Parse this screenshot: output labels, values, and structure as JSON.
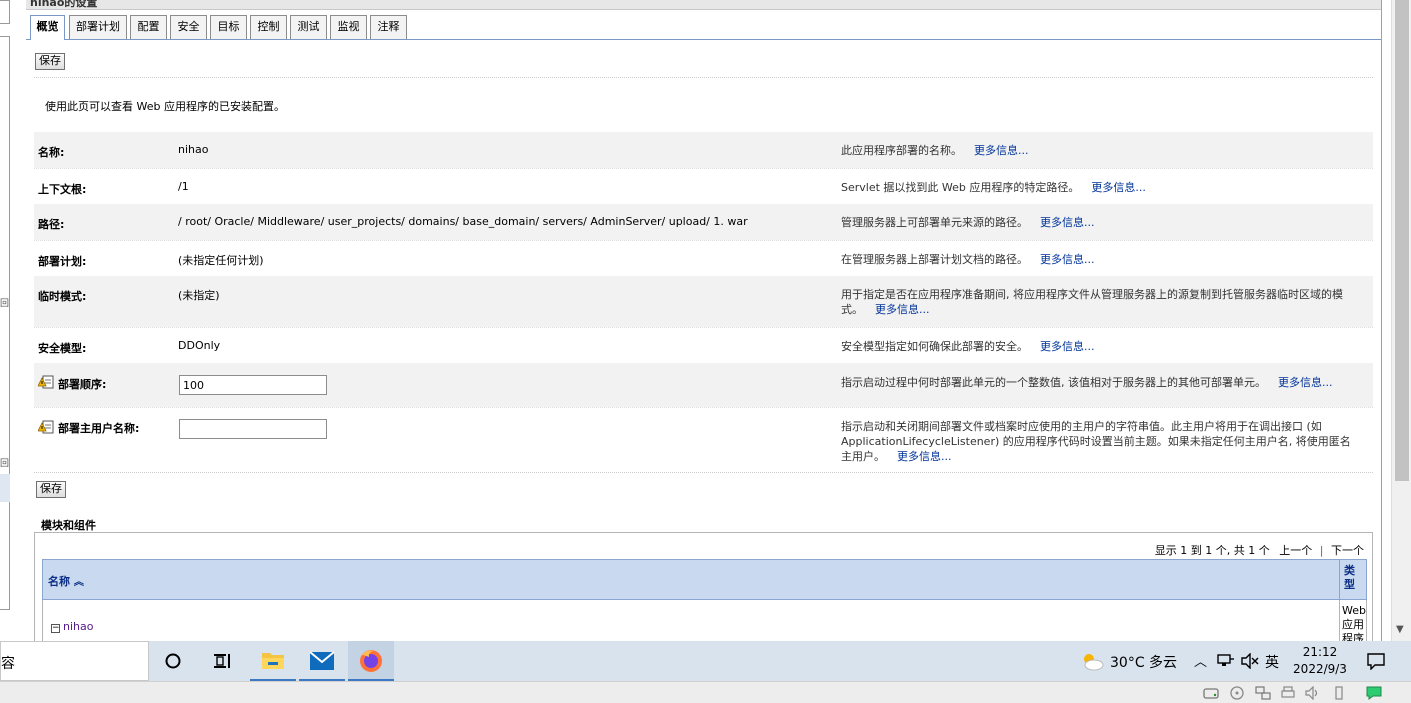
{
  "header": {
    "title": "nihao的设置"
  },
  "tabs": [
    {
      "label": "概览",
      "active": true
    },
    {
      "label": "部署计划"
    },
    {
      "label": "配置"
    },
    {
      "label": "安全"
    },
    {
      "label": "目标"
    },
    {
      "label": "控制"
    },
    {
      "label": "测试"
    },
    {
      "label": "监视"
    },
    {
      "label": "注释"
    }
  ],
  "buttons": {
    "save_label": "保存"
  },
  "intro": "使用此页可以查看 Web 应用程序的已安装配置。",
  "more_info": "更多信息...",
  "fields": {
    "name": {
      "label": "名称:",
      "value": "nihao",
      "desc": "此应用程序部署的名称。"
    },
    "context_root": {
      "label": "上下文根:",
      "value": "/1",
      "desc": "Servlet 据以找到此 Web 应用程序的特定路径。"
    },
    "path": {
      "label": "路径:",
      "value": "/ root/ Oracle/ Middleware/ user_projects/ domains/ base_domain/ servers/ AdminServer/ upload/ 1. war",
      "desc": "管理服务器上可部署单元来源的路径。"
    },
    "plan": {
      "label": "部署计划:",
      "value": "(未指定任何计划)",
      "desc": "在管理服务器上部署计划文档的路径。"
    },
    "staging": {
      "label": "临时模式:",
      "value": "(未指定)",
      "desc": "用于指定是否在应用程序准备期间, 将应用程序文件从管理服务器上的源复制到托管服务器临时区域的模式。"
    },
    "security_model": {
      "label": "安全模型:",
      "value": "DDOnly",
      "desc": "安全模型指定如何确保此部署的安全。"
    },
    "order": {
      "label": "部署顺序:",
      "value": "100",
      "desc": "指示启动过程中何时部署此单元的一个整数值, 该值相对于服务器上的其他可部署单元。"
    },
    "principal": {
      "label": "部署主用户名称:",
      "value": "",
      "desc": "指示启动和关闭期间部署文件或档案时应使用的主用户的字符串值。此主用户将用于在调出接口 (如 ApplicationLifecycleListener) 的应用程序代码时设置当前主题。如果未指定任何主用户名, 将使用匿名主用户。"
    }
  },
  "modules": {
    "title": "模块和组件",
    "pager_info": "显示 1 到 1 个, 共 1 个",
    "prev": "上一个",
    "pager_sep": "|",
    "next": "下一个",
    "col_name": "名称",
    "sort_indicator": "︽",
    "col_type": "类型",
    "toggle": "−",
    "rows": [
      {
        "name": "nihao",
        "type": "Web应用程序"
      }
    ]
  },
  "taskbar": {
    "search_fragment": "容",
    "weather": "30°C  多云",
    "ime": "英",
    "time": "21:12",
    "date": "2022/9/3",
    "colors": {
      "bar": "#d9e3ee",
      "active": "#c4d3e4",
      "underline": "#3c78c3"
    }
  }
}
